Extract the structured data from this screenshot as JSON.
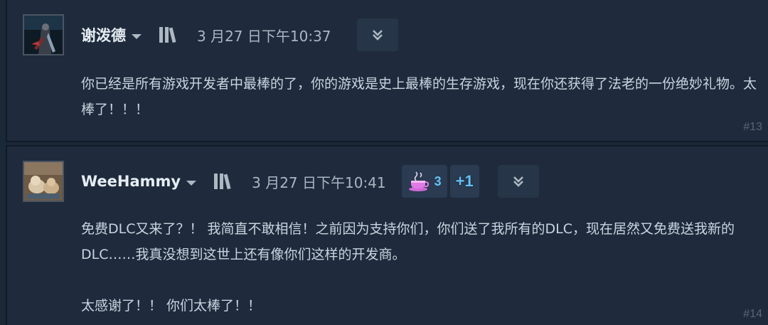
{
  "posts": [
    {
      "author": "谢泼德",
      "timestamp": "3 月27 日下午10:37",
      "body": "你已经是所有游戏开发者中最棒的了，你的游戏是史上最棒的生存游戏，现在你还获得了法老的一份绝妙礼物。太棒了！！！",
      "post_number": "#13",
      "icons": {
        "library": "library-icon",
        "collapse": "double-chevron-down-icon"
      }
    },
    {
      "author": "WeeHammy",
      "timestamp": "3 月27 日下午10:41",
      "award": {
        "icon": "tea-cup-award-icon",
        "count": "3"
      },
      "plus_one": "+1",
      "body": "免费DLC又来了？！ 我简直不敢相信！之前因为支持你们，你们送了我所有的DLC，现在居然又免费送我新的DLC……我真没想到这世上还有像你们这样的开发商。\n\n太感谢了！！ 你们太棒了！！",
      "post_number": "#14",
      "icons": {
        "library": "library-icon",
        "collapse": "double-chevron-down-icon"
      }
    }
  ],
  "colors": {
    "background": "#1b2838",
    "post_bg": "#1f2b3c",
    "author": "#e6edf3",
    "text": "#c7d5e0",
    "accent": "#66c0f4",
    "muted": "#56657a"
  }
}
